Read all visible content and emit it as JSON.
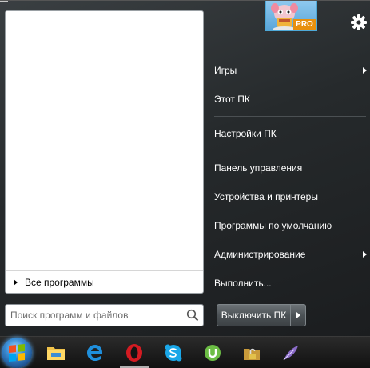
{
  "start_menu": {
    "left_pane": {
      "all_programs_label": "Все программы"
    },
    "search": {
      "placeholder": "Поиск программ и файлов",
      "value": ""
    },
    "user": {
      "badge": "PRO"
    },
    "right_items": [
      {
        "label": "Игры",
        "has_submenu": true
      },
      {
        "label": "Этот ПК",
        "has_submenu": false
      },
      {
        "label": "Настройки ПК",
        "has_submenu": false
      },
      {
        "label": "Панель управления",
        "has_submenu": false
      },
      {
        "label": "Устройства и принтеры",
        "has_submenu": false
      },
      {
        "label": "Программы по умолчанию",
        "has_submenu": false
      },
      {
        "label": "Администрирование",
        "has_submenu": true
      },
      {
        "label": "Выполнить...",
        "has_submenu": false
      }
    ],
    "shutdown": {
      "label": "Выключить ПК"
    }
  },
  "taskbar": {
    "pinned": [
      {
        "name": "file-explorer-icon"
      },
      {
        "name": "edge-icon"
      },
      {
        "name": "opera-icon"
      },
      {
        "name": "skype-icon"
      },
      {
        "name": "utorrent-icon"
      },
      {
        "name": "lock-folder-icon"
      },
      {
        "name": "feather-app-icon"
      }
    ],
    "active_index": 2
  },
  "colors": {
    "accent_blue": "#4ea9d8",
    "pro_badge": "#e8900c",
    "opera_red": "#d41b22",
    "skype_blue": "#1aa7e8",
    "utorrent_green": "#6cbd45"
  }
}
